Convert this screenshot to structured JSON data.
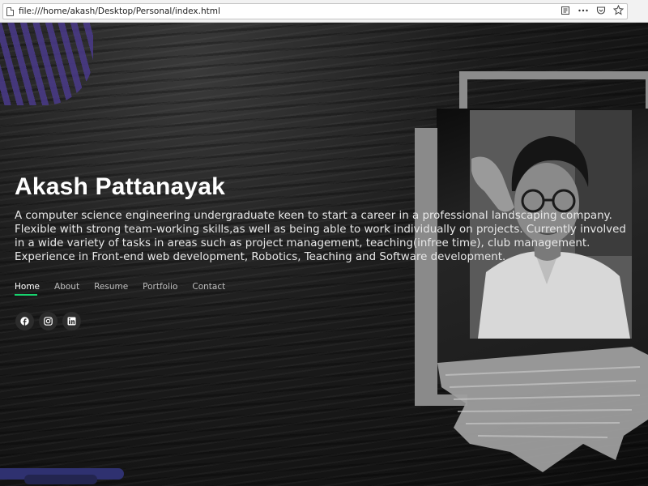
{
  "browser": {
    "url": "file:///home/akash/Desktop/Personal/index.html"
  },
  "hero": {
    "name": "Akash Pattanayak",
    "bio": "A computer science engineering undergraduate keen to start a career in a professional landscaping company. Flexible with strong team-working skills,as well as being able to work individually on projects. Currently involved in a wide variety of tasks in areas such as project management, teaching(infree time), club management. Experience in Front-end web development, Robotics, Teaching and Software development."
  },
  "nav": {
    "items": [
      {
        "label": "Home",
        "active": true
      },
      {
        "label": "About"
      },
      {
        "label": "Resume"
      },
      {
        "label": "Portfolio"
      },
      {
        "label": "Contact"
      }
    ]
  },
  "socials": [
    {
      "icon": "facebook-icon"
    },
    {
      "icon": "instagram-icon"
    },
    {
      "icon": "linkedin-icon"
    }
  ],
  "colors": {
    "accent": "#18d26e",
    "stripes": "#4a3a8a",
    "frame": "#8c8c8c"
  }
}
